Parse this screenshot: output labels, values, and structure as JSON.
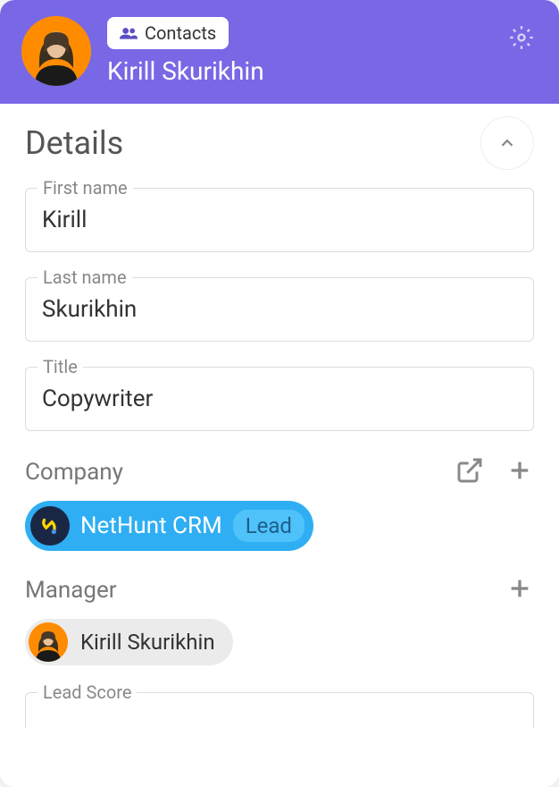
{
  "header": {
    "contacts_label": "Contacts",
    "contact_name": "Kirill Skurikhin"
  },
  "details": {
    "section_title": "Details",
    "first_name": {
      "label": "First name",
      "value": "Kirill"
    },
    "last_name": {
      "label": "Last name",
      "value": "Skurikhin"
    },
    "title": {
      "label": "Title",
      "value": "Copywriter"
    },
    "company": {
      "label": "Company",
      "name": "NetHunt CRM",
      "status": "Lead"
    },
    "manager": {
      "label": "Manager",
      "name": "Kirill Skurikhin"
    },
    "lead_score": {
      "label": "Lead Score"
    }
  }
}
